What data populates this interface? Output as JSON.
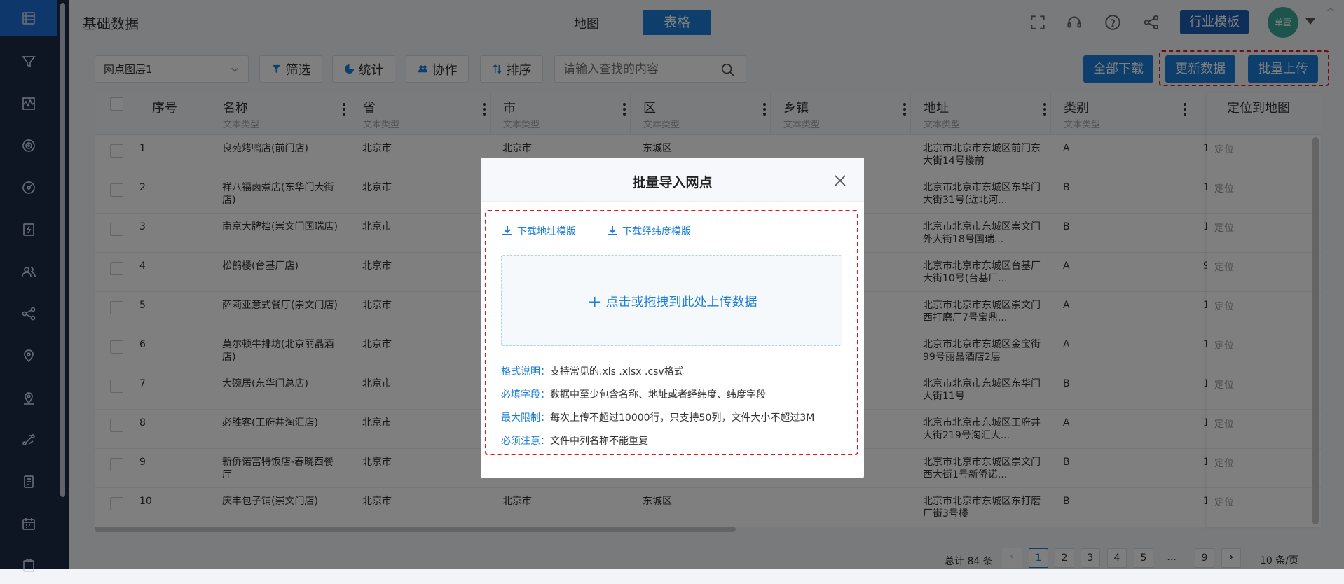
{
  "header": {
    "title": "基础数据",
    "view_map": "地图",
    "view_table": "表格",
    "industry_button": "行业模板",
    "avatar_text": "单壹"
  },
  "toolbar": {
    "layer_select": "网点图层1",
    "filter": "筛选",
    "stats": "统计",
    "collab": "协作",
    "sort": "排序",
    "search_placeholder": "请输入查找的内容",
    "download_all": "全部下载",
    "update_data": "更新数据",
    "batch_upload": "批量上传"
  },
  "table": {
    "columns": [
      {
        "name": "序号",
        "type": ""
      },
      {
        "name": "名称",
        "type": "文本类型"
      },
      {
        "name": "省",
        "type": "文本类型"
      },
      {
        "name": "市",
        "type": "文本类型"
      },
      {
        "name": "区",
        "type": "文本类型"
      },
      {
        "name": "乡镇",
        "type": "文本类型"
      },
      {
        "name": "地址",
        "type": "文本类型"
      },
      {
        "name": "类别",
        "type": "文本类型"
      },
      {
        "name": "定位到地图",
        "type": ""
      }
    ],
    "rows": [
      {
        "no": "1",
        "name": "良苑烤鸭店(前门店)",
        "prov": "北京市",
        "city": "北京市",
        "dist": "东城区",
        "town": "",
        "addr": "北京市北京市东城区前门东大街14号楼前",
        "cat": "A",
        "hint": "1",
        "locate": "定位"
      },
      {
        "no": "2",
        "name": "祥八福卤煮店(东华门大街店)",
        "prov": "北京市",
        "city": "",
        "dist": "",
        "town": "",
        "addr": "北京市北京市东城区东华门大街31号(近北河...",
        "cat": "B",
        "hint": "1",
        "locate": "定位"
      },
      {
        "no": "3",
        "name": "南京大牌档(崇文门国瑞店)",
        "prov": "北京市",
        "city": "",
        "dist": "",
        "town": "",
        "addr": "北京市北京市东城区崇文门外大街18号国瑞...",
        "cat": "B",
        "hint": "1",
        "locate": "定位"
      },
      {
        "no": "4",
        "name": "松鹤楼(台基厂店)",
        "prov": "北京市",
        "city": "",
        "dist": "",
        "town": "",
        "addr": "北京市北京市东城区台基厂大街10号(台基厂...",
        "cat": "A",
        "hint": "9",
        "locate": "定位"
      },
      {
        "no": "5",
        "name": "萨莉亚意式餐厅(崇文门店)",
        "prov": "北京市",
        "city": "",
        "dist": "",
        "town": "",
        "addr": "北京市北京市东城区崇文门西打磨厂7号宝鼎...",
        "cat": "A",
        "hint": "1",
        "locate": "定位"
      },
      {
        "no": "6",
        "name": "莫尔顿牛排坊(北京丽晶酒店)",
        "prov": "北京市",
        "city": "",
        "dist": "",
        "town": "",
        "addr": "北京市北京市东城区金宝街99号丽晶酒店2层",
        "cat": "A",
        "hint": "1",
        "locate": "定位"
      },
      {
        "no": "7",
        "name": "大碗居(东华门总店)",
        "prov": "北京市",
        "city": "",
        "dist": "",
        "town": "",
        "addr": "北京市北京市东城区东华门大街11号",
        "cat": "B",
        "hint": "1",
        "locate": "定位"
      },
      {
        "no": "8",
        "name": "必胜客(王府井淘汇店)",
        "prov": "北京市",
        "city": "",
        "dist": "",
        "town": "",
        "addr": "北京市北京市东城区王府井大街219号淘汇大...",
        "cat": "A",
        "hint": "1",
        "locate": "定位"
      },
      {
        "no": "9",
        "name": "新侨诺富特饭店-春晓西餐厅",
        "prov": "北京市",
        "city": "",
        "dist": "",
        "town": "",
        "addr": "北京市北京市东城区崇文门西大街1号新侨诺...",
        "cat": "B",
        "hint": "1",
        "locate": "定位"
      },
      {
        "no": "10",
        "name": "庆丰包子铺(崇文门店)",
        "prov": "北京市",
        "city": "北京市",
        "dist": "东城区",
        "town": "",
        "addr": "北京市北京市东城区东打磨厂街3号楼",
        "cat": "B",
        "hint": "1",
        "locate": "定位"
      }
    ]
  },
  "pagination": {
    "total": "总计 84 条",
    "pages": [
      "1",
      "2",
      "3",
      "4",
      "5"
    ],
    "ellipsis": "...",
    "last": "9",
    "prev": "‹",
    "next": "›",
    "page_size": "10 条/页"
  },
  "modal": {
    "title": "批量导入网点",
    "download_address_template": "下载地址模版",
    "download_latlng_template": "下载经纬度模版",
    "dropzone_text": "点击或拖拽到此处上传数据",
    "notes": [
      {
        "key": "格式说明：",
        "value": "支持常见的.xls .xlsx .csv格式"
      },
      {
        "key": "必填字段：",
        "value": "数据中至少包含名称、地址或者经纬度、纬度字段"
      },
      {
        "key": "最大限制：",
        "value": "每次上传不超过10000行，只支持50列，文件大小不超过3M"
      },
      {
        "key": "必须注意：",
        "value": "文件中列名称不能重复"
      }
    ]
  },
  "colors": {
    "primary": "#1d7ed8",
    "sidebar": "#1c2b46",
    "highlight": "#e6141e"
  }
}
